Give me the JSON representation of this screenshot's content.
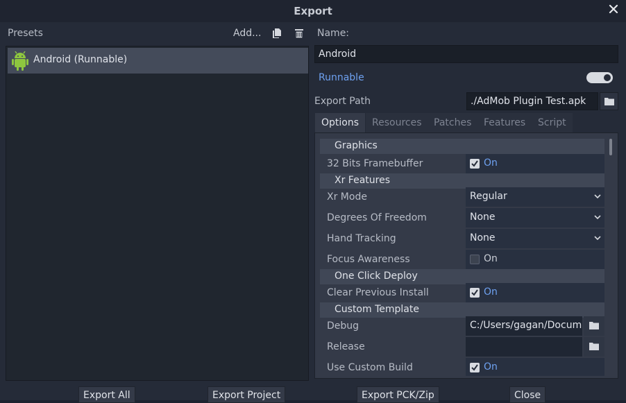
{
  "window": {
    "title": "Export"
  },
  "presets": {
    "label": "Presets",
    "add_label": "Add...",
    "items": [
      {
        "label": "Android (Runnable)",
        "icon": "android-icon"
      }
    ]
  },
  "form": {
    "name_label": "Name:",
    "name_value": "Android",
    "runnable_label": "Runnable",
    "runnable_on": true,
    "export_path_label": "Export Path",
    "export_path_value": "./AdMob Plugin Test.apk"
  },
  "tabs": [
    "Options",
    "Resources",
    "Patches",
    "Features",
    "Script"
  ],
  "active_tab": "Options",
  "options": {
    "graphics": {
      "header": "Graphics",
      "fb_label": "32 Bits Framebuffer",
      "fb_value": "On"
    },
    "xr": {
      "header": "Xr Features",
      "mode_label": "Xr Mode",
      "mode_value": "Regular",
      "dof_label": "Degrees Of Freedom",
      "dof_value": "None",
      "hand_label": "Hand Tracking",
      "hand_value": "None",
      "focus_label": "Focus Awareness",
      "focus_value": "On"
    },
    "deploy": {
      "header": "One Click Deploy",
      "clear_label": "Clear Previous Install",
      "clear_value": "On"
    },
    "template": {
      "header": "Custom Template",
      "debug_label": "Debug",
      "debug_value": "C:/Users/gagan/Docum",
      "release_label": "Release",
      "release_value": "",
      "build_label": "Use Custom Build",
      "build_value": "On"
    }
  },
  "buttons": {
    "export_all": "Export All",
    "export_project": "Export Project",
    "export_pck": "Export PCK/Zip",
    "close": "Close"
  },
  "colors": {
    "accent": "#6ea1f0",
    "android": "#8ec63f"
  }
}
